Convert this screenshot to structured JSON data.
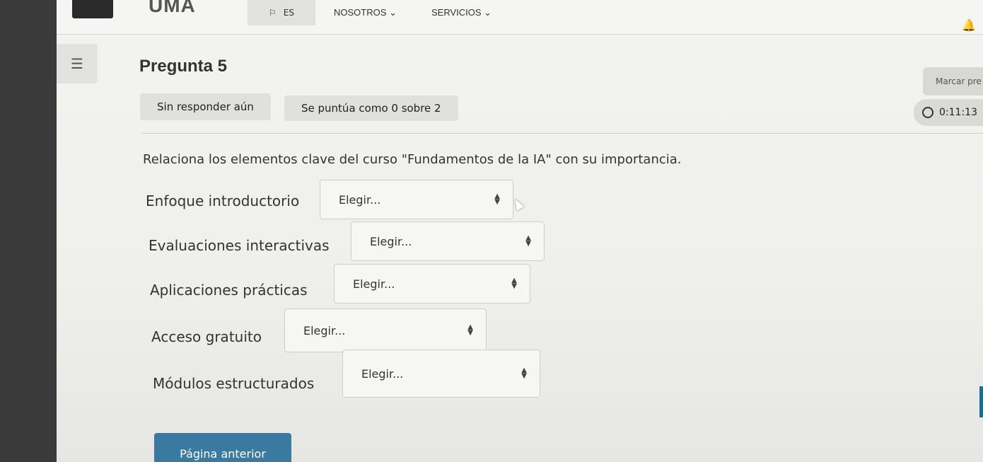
{
  "header": {
    "logo": "UMA",
    "lang": "ES",
    "nav": [
      "NOSOTROS ⌄",
      "SERVICIOS ⌄"
    ]
  },
  "question": {
    "title": "Pregunta 5",
    "flag_label": "Marcar pre",
    "status": "Sin responder aún",
    "grade": "Se puntúa como 0 sobre 2",
    "timer": "0:11:13",
    "text": "Relaciona los elementos clave del curso \"Fundamentos de la IA\" con su importancia."
  },
  "matches": [
    {
      "label": "Enfoque introductorio",
      "choice": "Elegir..."
    },
    {
      "label": "Evaluaciones interactivas",
      "choice": "Elegir..."
    },
    {
      "label": "Aplicaciones prácticas",
      "choice": "Elegir..."
    },
    {
      "label": "Acceso gratuito",
      "choice": "Elegir..."
    },
    {
      "label": "Módulos estructurados",
      "choice": "Elegir..."
    }
  ],
  "footer": {
    "prev_label": "Página anterior"
  },
  "colors": {
    "accent": "#3a7aa0",
    "page_bg": "#f0f0ee"
  }
}
